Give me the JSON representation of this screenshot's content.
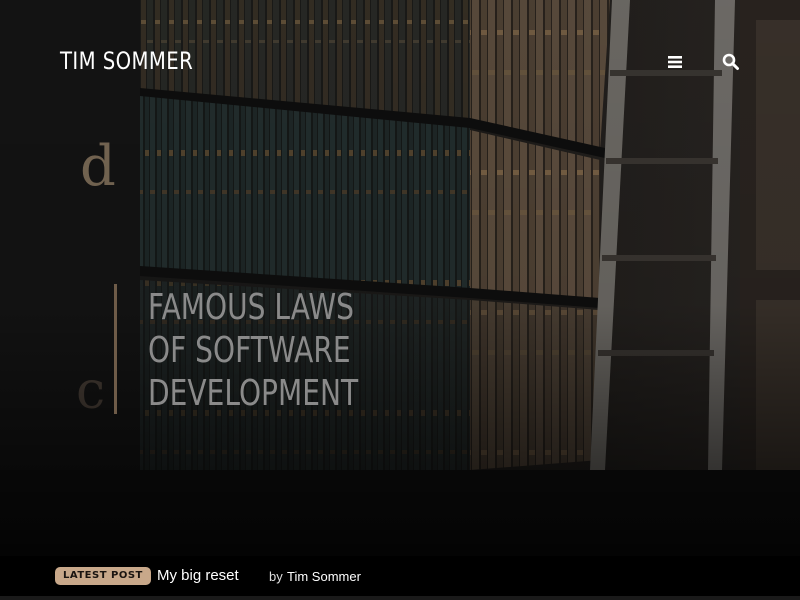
{
  "header": {
    "site_title": "TIM SOMMER",
    "menu_icon": "hamburger-menu-icon",
    "search_icon": "search-icon"
  },
  "feature": {
    "title_lines": [
      "FAMOUS LAWS",
      "OF SOFTWARE",
      "DEVELOPMENT"
    ]
  },
  "latest": {
    "badge": "LATEST POST",
    "title": "My big reset",
    "by": "by",
    "author": "Tim Sommer"
  },
  "colors": {
    "badge_bg": "#c8a88a",
    "feature_bar": "#6e5b48",
    "title_text": "#8a8a8a"
  }
}
